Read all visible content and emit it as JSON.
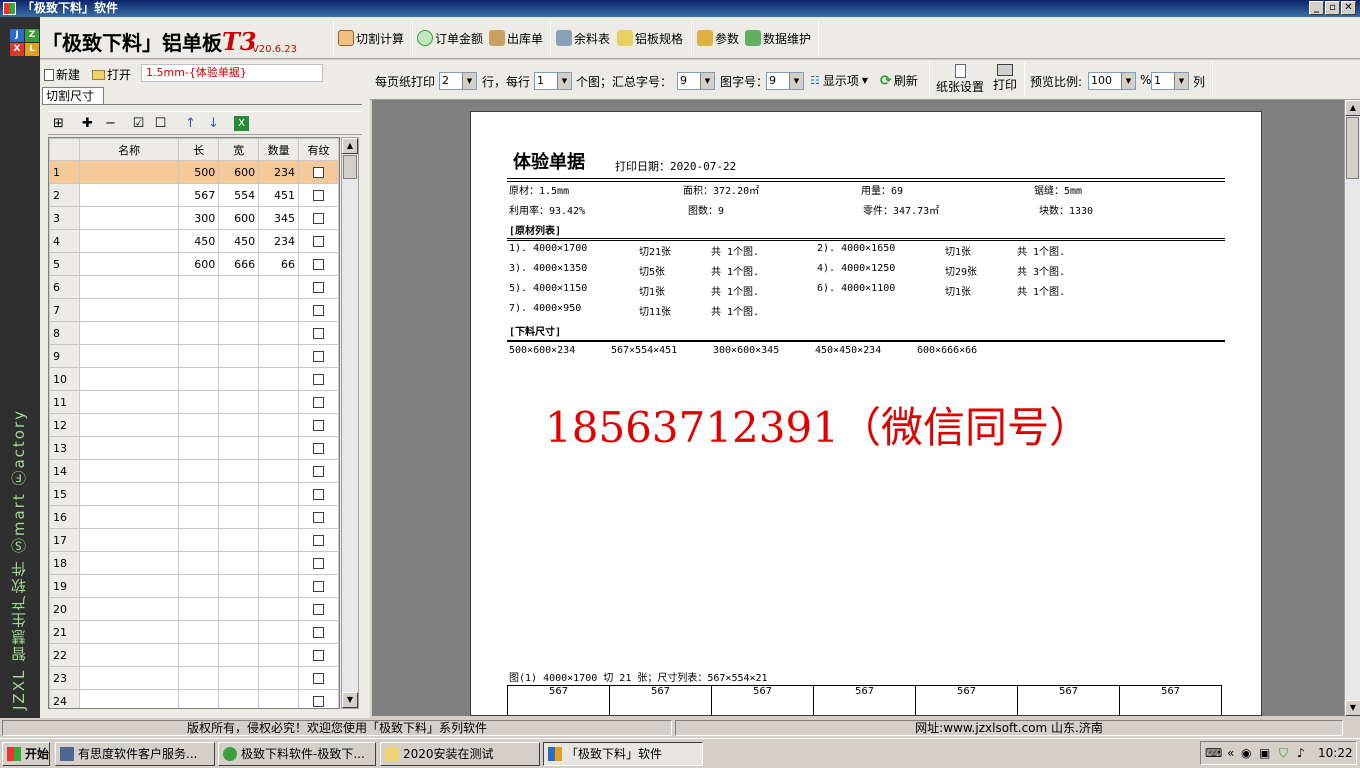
{
  "window": {
    "title": "「极致下料」软件",
    "min": "_",
    "max": "▫",
    "close": "✕"
  },
  "brand": {
    "logo_letters": [
      "J",
      "Z",
      "X",
      "L"
    ],
    "name": "「极致下料」铝单板",
    "model": "T3",
    "version": "V20.6.23",
    "vertical_slogan": "JZXL 智慧生产软件 Ⓢmart Ⓕactory"
  },
  "top_buttons": [
    {
      "icon": "calculator-icon",
      "label": "切割计算"
    },
    {
      "icon": "money-icon",
      "label": "订单金额"
    },
    {
      "icon": "truck-icon",
      "label": "出库单"
    },
    {
      "icon": "leftover-icon",
      "label": "余料表"
    },
    {
      "icon": "board-spec-icon",
      "label": "铝板规格"
    },
    {
      "icon": "parameters-icon",
      "label": "参数"
    },
    {
      "icon": "database-icon",
      "label": "数据维护"
    }
  ],
  "file_toolbar": {
    "new_label": "新建",
    "open_label": "打开",
    "current_file": "1.5mm-{体验单据}"
  },
  "tab": {
    "label": "切割尺寸"
  },
  "grid": {
    "columns": [
      "名称",
      "长",
      "宽",
      "数量",
      "有纹"
    ],
    "rows": [
      {
        "n": "1",
        "name": "",
        "l": "500",
        "w": "600",
        "q": "234"
      },
      {
        "n": "2",
        "name": "",
        "l": "567",
        "w": "554",
        "q": "451"
      },
      {
        "n": "3",
        "name": "",
        "l": "300",
        "w": "600",
        "q": "345"
      },
      {
        "n": "4",
        "name": "",
        "l": "450",
        "w": "450",
        "q": "234"
      },
      {
        "n": "5",
        "name": "",
        "l": "600",
        "w": "666",
        "q": "66"
      },
      {
        "n": "6"
      },
      {
        "n": "7"
      },
      {
        "n": "8"
      },
      {
        "n": "9"
      },
      {
        "n": "10"
      },
      {
        "n": "11"
      },
      {
        "n": "12"
      },
      {
        "n": "13"
      },
      {
        "n": "14"
      },
      {
        "n": "15"
      },
      {
        "n": "16"
      },
      {
        "n": "17"
      },
      {
        "n": "18"
      },
      {
        "n": "19"
      },
      {
        "n": "20"
      },
      {
        "n": "21"
      },
      {
        "n": "22"
      },
      {
        "n": "23"
      },
      {
        "n": "24"
      }
    ]
  },
  "preview_toolbar": {
    "per_page_label": "每页纸打印",
    "per_page_value": "2",
    "rows_label": "行，每行",
    "per_row_value": "1",
    "figs_label": "个图；汇总字号：",
    "summary_font": "9",
    "fig_font_label": "图字号：",
    "fig_font": "9",
    "display_label": "显示项",
    "refresh_label": "刷新",
    "paper_setup_label": "纸张设置",
    "print_label": "打印",
    "zoom_label": "预览比例:",
    "zoom_value": "100",
    "percent": "%",
    "columns_value": "1",
    "columns_label": "列"
  },
  "document": {
    "title": "体验单据",
    "print_date": "打印日期：2020-07-22",
    "info_row1": [
      "原材：1.5mm",
      "面积：372.20㎡",
      "用量：69",
      "锯缝：5mm"
    ],
    "info_row2": [
      "利用率：93.42%",
      "图数：9",
      "零件：347.73㎡",
      "块数：1330"
    ],
    "raw_section": "[原材列表]",
    "raw_items": [
      [
        "1). 4000×1700",
        "切21张",
        "共 1个图."
      ],
      [
        "2). 4000×1650",
        "切1张",
        "共 1个图."
      ],
      [
        "3). 4000×1350",
        "切5张",
        "共 1个图."
      ],
      [
        "4). 4000×1250",
        "切29张",
        "共 3个图."
      ],
      [
        "5). 4000×1150",
        "切1张",
        "共 1个图."
      ],
      [
        "6). 4000×1100",
        "切1张",
        "共 1个图."
      ],
      [
        "7). 4000×950",
        "切11张",
        "共 1个图."
      ]
    ],
    "cut_section": "[下料尺寸]",
    "cut_sizes": [
      "500×600×234",
      "567×554×451",
      "300×600×345",
      "450×450×234",
      "600×666×66"
    ],
    "watermark_phone": "18563712391（微信同号）",
    "figure_caption": "图(1) 4000×1700 切 21 张；尺寸列表：567×554×21",
    "tiles": [
      "567",
      "567",
      "567",
      "567",
      "567",
      "567",
      "567"
    ]
  },
  "status": {
    "left": "版权所有，侵权必究！欢迎您使用「极致下料」系列软件",
    "right": "网址:www.jzxlsoft.com 山东.济南"
  },
  "taskbar": {
    "start": "开始",
    "tasks": [
      "有思度软件客户服务...",
      "极致下料软件-极致下...",
      "2020安装在测试",
      "「极致下料」软件"
    ],
    "clock": "10:22"
  },
  "colors": {
    "accent_red": "#e00000",
    "selection": "#f5c89a",
    "title_bar": "#0a246a"
  }
}
